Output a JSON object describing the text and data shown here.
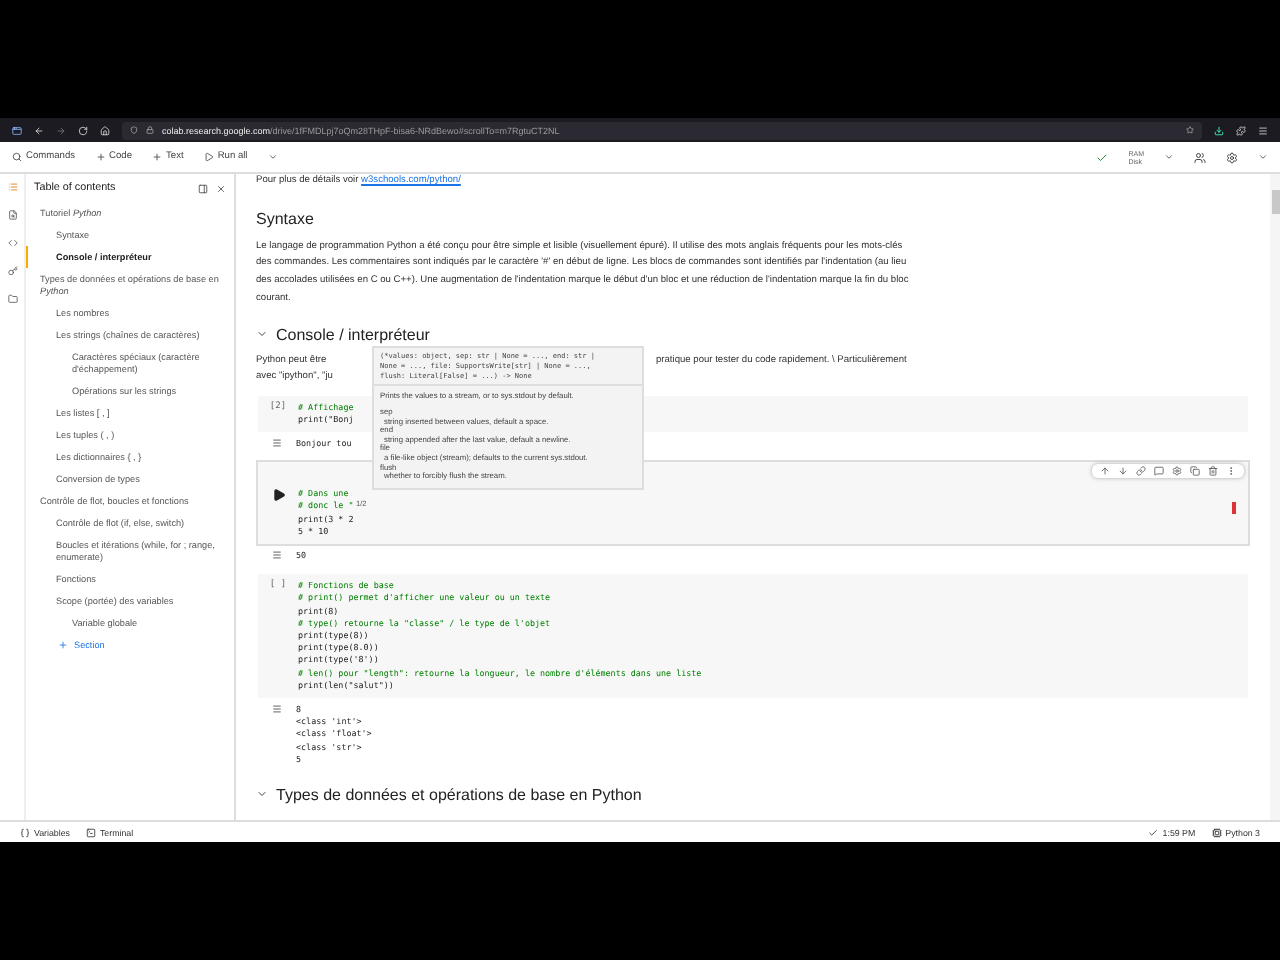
{
  "browser": {
    "url_host": "colab.research.google.com",
    "url_path": "/drive/1fFMDLpj7oQm28THpF-bisa6-NRdBewo#scrollTo=m7RgtuCT2NL"
  },
  "toolbar": {
    "commands": "Commands",
    "add_code": "Code",
    "add_text": "Text",
    "run_all": "Run all",
    "ram": "RAM",
    "disk": "Disk"
  },
  "sidebar": {
    "title": "Table of contents",
    "add_section": "Section",
    "items": [
      {
        "label": "Tutoriel *Python*",
        "selected": false,
        "children": [
          {
            "label": "Syntaxe",
            "selected": false
          },
          {
            "label": "Console / interpréteur",
            "selected": true
          }
        ]
      },
      {
        "label": "Types de données et opérations de base en *Python*",
        "selected": false,
        "children": [
          {
            "label": "Les nombres",
            "selected": false
          },
          {
            "label": "Les strings (chaînes de caractères)",
            "selected": false,
            "children": [
              {
                "label": "Caractères spéciaux (caractère d'échappement)",
                "selected": false
              },
              {
                "label": "Opérations sur les strings",
                "selected": false
              }
            ]
          },
          {
            "label": "Les listes [ , ]",
            "selected": false
          },
          {
            "label": "Les tuples ( , )",
            "selected": false
          },
          {
            "label": "Les dictionnaires { , }",
            "selected": false
          },
          {
            "label": "Conversion de types",
            "selected": false
          }
        ]
      },
      {
        "label": "Contrôle de flot, boucles et fonctions",
        "selected": false,
        "children": [
          {
            "label": "Contrôle de flot (if, else, switch)",
            "selected": false
          },
          {
            "label": "Boucles et itérations (while, for ; range, enumerate)",
            "selected": false
          },
          {
            "label": "Fonctions",
            "selected": false
          },
          {
            "label": "Scope (portée) des variables",
            "selected": false,
            "children": [
              {
                "label": "Variable globale",
                "selected": false
              }
            ]
          }
        ]
      }
    ]
  },
  "blocks": [
    {
      "kind": "link_text",
      "text": "Pour plus de détails voir",
      "link": "w3schools.com/python/"
    },
    {
      "kind": "heading",
      "text": "Syntaxe"
    },
    {
      "kind": "paragraph",
      "text": "Le langage de programmation Python a été conçu pour être simple et lisible (visuellement épuré). Il utilise des mots anglais fréquents pour les mots-clés des commandes. Les commentaires sont indiqués par le caractère '#' en début de ligne. Les blocs de commandes sont identifiés par l'indentation (au lieu des accolades utilisées en C ou C++). Une augmentation de l'indentation marque le début d'un bloc et une réduction de l'indentation marque la fin du bloc courant."
    },
    {
      "kind": "section",
      "text": "Console / interpréteur"
    },
    {
      "kind": "split_paragraph",
      "left": "Python peut être",
      "right": "pratique pour tester du code rapidement. \\ Particulièrement",
      "line2": "avec \"ipython\", \"ju"
    },
    {
      "kind": "code",
      "active": false,
      "run_label": "[2]",
      "lines": [
        {
          "kind": "comment",
          "text": "# Affichage"
        },
        {
          "kind": "code",
          "text": "print(\"Bonj"
        }
      ],
      "output": [
        "Bonjour tou"
      ]
    },
    {
      "kind": "code",
      "active": true,
      "lines": [
        {
          "kind": "comment",
          "text": "# Dans une"
        },
        {
          "kind": "comment",
          "text": "# donc le \""
        },
        {
          "kind": "code",
          "text": "print(3 * 2"
        },
        {
          "kind": "code",
          "text": "5 * 10"
        }
      ],
      "output": [
        "50"
      ]
    },
    {
      "kind": "code",
      "active": false,
      "run_label": "[ ]",
      "lines": [
        {
          "kind": "comment",
          "text": "# Fonctions de base"
        },
        {
          "kind": "comment",
          "text": "# print() permet d'afficher une valeur ou un texte"
        },
        {
          "kind": "code",
          "text": "print(8)"
        },
        {
          "kind": "comment",
          "text": "# type() retourne la \"classe\" / le type de l'objet"
        },
        {
          "kind": "code",
          "text": "print(type(8))"
        },
        {
          "kind": "code",
          "text": "print(type(8.0))"
        },
        {
          "kind": "code",
          "text": "print(type('8'))"
        },
        {
          "kind": "comment",
          "text": "# len() pour \"length\": retourne la longueur, le nombre d'éléments dans une liste"
        },
        {
          "kind": "code",
          "text": "print(len(\"salut\"))"
        }
      ],
      "output": [
        "8",
        "<class 'int'>",
        "<class 'float'>",
        "<class 'str'>",
        "5"
      ]
    },
    {
      "kind": "section",
      "text": "Types de données et opérations de base en Python"
    }
  ],
  "tooltip": {
    "signature": [
      "(*values: object, sep: str | None = ..., end: str |",
      "None = ..., file: SupportsWrite[str] | None = ...,",
      "flush: Literal[False] = ...) -> None"
    ],
    "description": "Prints the values to a stream, or to sys.stdout by default.",
    "params": [
      {
        "name": "sep",
        "desc": "string inserted between values, default a space."
      },
      {
        "name": "end",
        "desc": "string appended after the last value, default a newline."
      },
      {
        "name": "file",
        "desc": "a file-like object (stream); defaults to the current sys.stdout."
      },
      {
        "name": "flush",
        "desc": "whether to forcibly flush the stream."
      }
    ],
    "pager": "1/2"
  },
  "status_bar": {
    "variables": "Variables",
    "terminal": "Terminal",
    "time": "1:59 PM",
    "runtime": "Python 3"
  }
}
